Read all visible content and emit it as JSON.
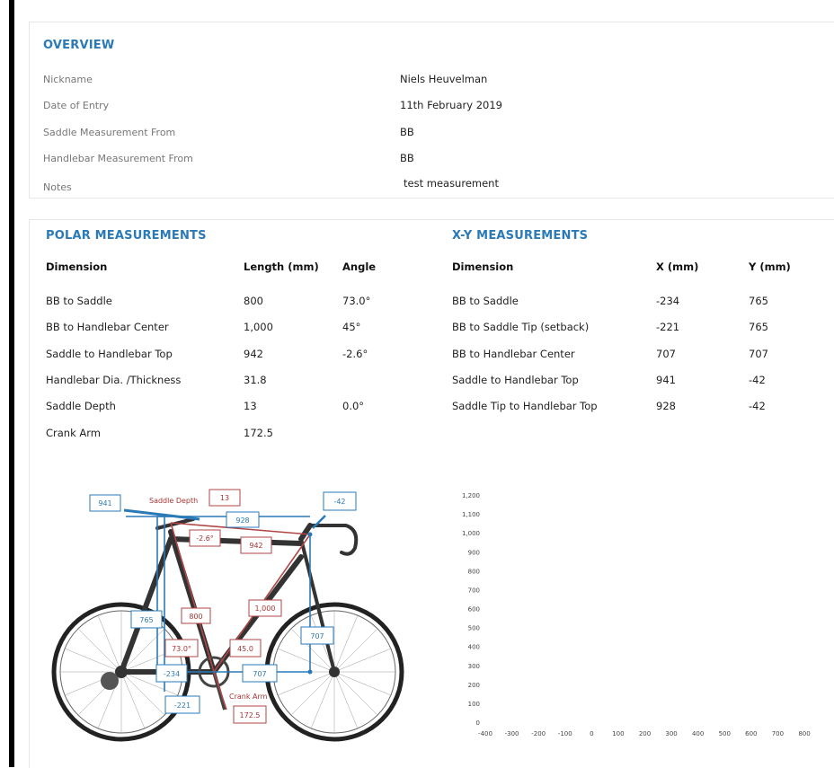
{
  "overview": {
    "title": "OVERVIEW",
    "rows": [
      {
        "label": "Nickname",
        "value": "Niels Heuvelman"
      },
      {
        "label": "Date of Entry",
        "value": "11th February 2019"
      },
      {
        "label": "Saddle Measurement From",
        "value": "BB"
      },
      {
        "label": "Handlebar Measurement From",
        "value": "BB"
      },
      {
        "label": "Notes",
        "value": "test measurement"
      }
    ]
  },
  "polar": {
    "title": "POLAR MEASUREMENTS",
    "headers": [
      "Dimension",
      "Length (mm)",
      "Angle"
    ],
    "rows": [
      [
        "BB to Saddle",
        "800",
        "73.0°"
      ],
      [
        "BB to Handlebar Center",
        "1,000",
        "45°"
      ],
      [
        "Saddle to Handlebar Top",
        "942",
        "-2.6°"
      ],
      [
        "Handlebar Dia. /Thickness",
        "31.8",
        ""
      ],
      [
        "Saddle Depth",
        "13",
        "0.0°"
      ],
      [
        "Crank Arm",
        "172.5",
        ""
      ]
    ]
  },
  "xy": {
    "title": "X-Y MEASUREMENTS",
    "headers": [
      "Dimension",
      "X (mm)",
      "Y (mm)"
    ],
    "rows": [
      [
        "BB to Saddle",
        "-234",
        "765"
      ],
      [
        "BB to Saddle Tip (setback)",
        "-221",
        "765"
      ],
      [
        "BB to Handlebar Center",
        "707",
        "707"
      ],
      [
        "Saddle to Handlebar Top",
        "941",
        "-42"
      ],
      [
        "Saddle Tip to Handlebar Top",
        "928",
        "-42"
      ]
    ]
  },
  "diagram": {
    "labels": {
      "saddle_depth": "Saddle Depth",
      "saddle_depth_val": "13",
      "sadtop_x": "941",
      "tip_x": "928",
      "neg42": "-42",
      "ang26": "-2.6°",
      "len942": "942",
      "y765": "765",
      "len800": "800",
      "len1000": "1,000",
      "ang73": "73.0°",
      "ang45": "45.0",
      "y707": "707",
      "neg234": "-234",
      "x707": "707",
      "neg221": "-221",
      "crank_arm": "Crank Arm",
      "crank_val": "172.5"
    },
    "colors": {
      "blue": "#2a7ab8",
      "red": "#b04545",
      "frame": "#333333"
    }
  },
  "chart_data": {
    "type": "scatter",
    "series": [],
    "x_ticks": [
      "-400",
      "-300",
      "-200",
      "-100",
      "0",
      "100",
      "200",
      "300",
      "400",
      "500",
      "600",
      "700",
      "800"
    ],
    "y_ticks": [
      "0",
      "100",
      "200",
      "300",
      "400",
      "500",
      "600",
      "700",
      "800",
      "900",
      "1,000",
      "1,100",
      "1,200"
    ],
    "xlim": [
      -400,
      800
    ],
    "ylim": [
      0,
      1200
    ]
  }
}
